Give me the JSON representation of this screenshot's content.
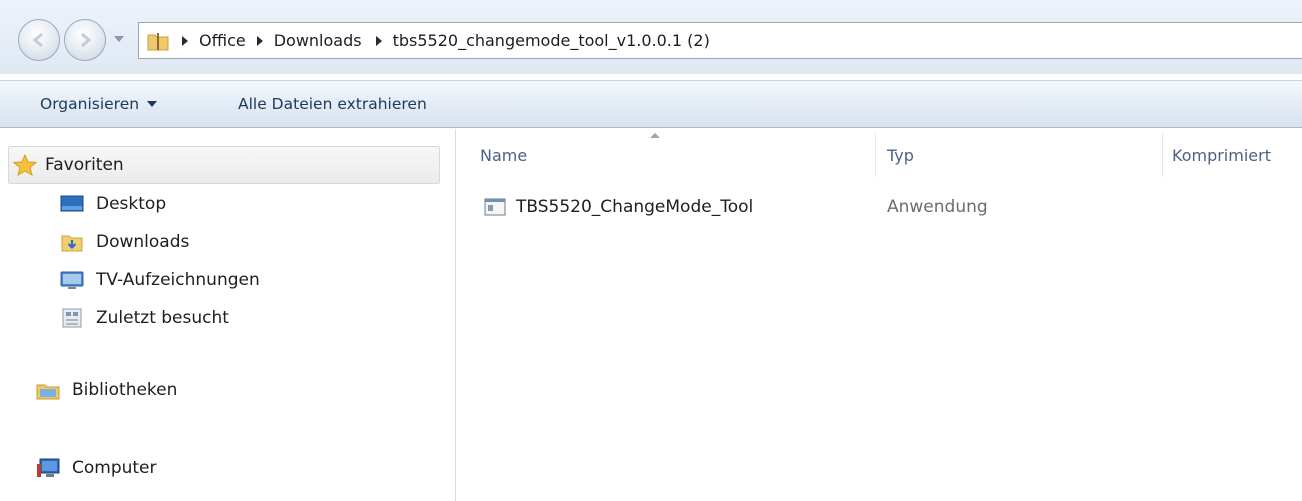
{
  "window": {
    "breadcrumbs": [
      "Office",
      "Downloads",
      "tbs5520_changemode_tool_v1.0.0.1 (2)"
    ]
  },
  "toolbar": {
    "organize_label": "Organisieren",
    "extract_all_label": "Alle Dateien extrahieren"
  },
  "sidebar": {
    "favorites": {
      "label": "Favoriten",
      "icon": "star-icon"
    },
    "items": [
      {
        "label": "Desktop",
        "icon": "desktop-icon"
      },
      {
        "label": "Downloads",
        "icon": "downloads-folder-icon"
      },
      {
        "label": "TV-Aufzeichnungen",
        "icon": "tv-icon"
      },
      {
        "label": "Zuletzt besucht",
        "icon": "recent-places-icon"
      }
    ],
    "libraries": {
      "label": "Bibliotheken",
      "icon": "libraries-icon"
    },
    "computer": {
      "label": "Computer",
      "icon": "computer-icon"
    }
  },
  "content": {
    "columns": {
      "name": "Name",
      "type": "Typ",
      "compressed": "Komprimiert"
    },
    "files": [
      {
        "name": "TBS5520_ChangeMode_Tool",
        "type": "Anwendung",
        "icon": "application-icon"
      }
    ]
  },
  "colors": {
    "command_text": "#1e395b",
    "column_header_text": "#4d6185",
    "type_text": "#6d6d6d"
  }
}
